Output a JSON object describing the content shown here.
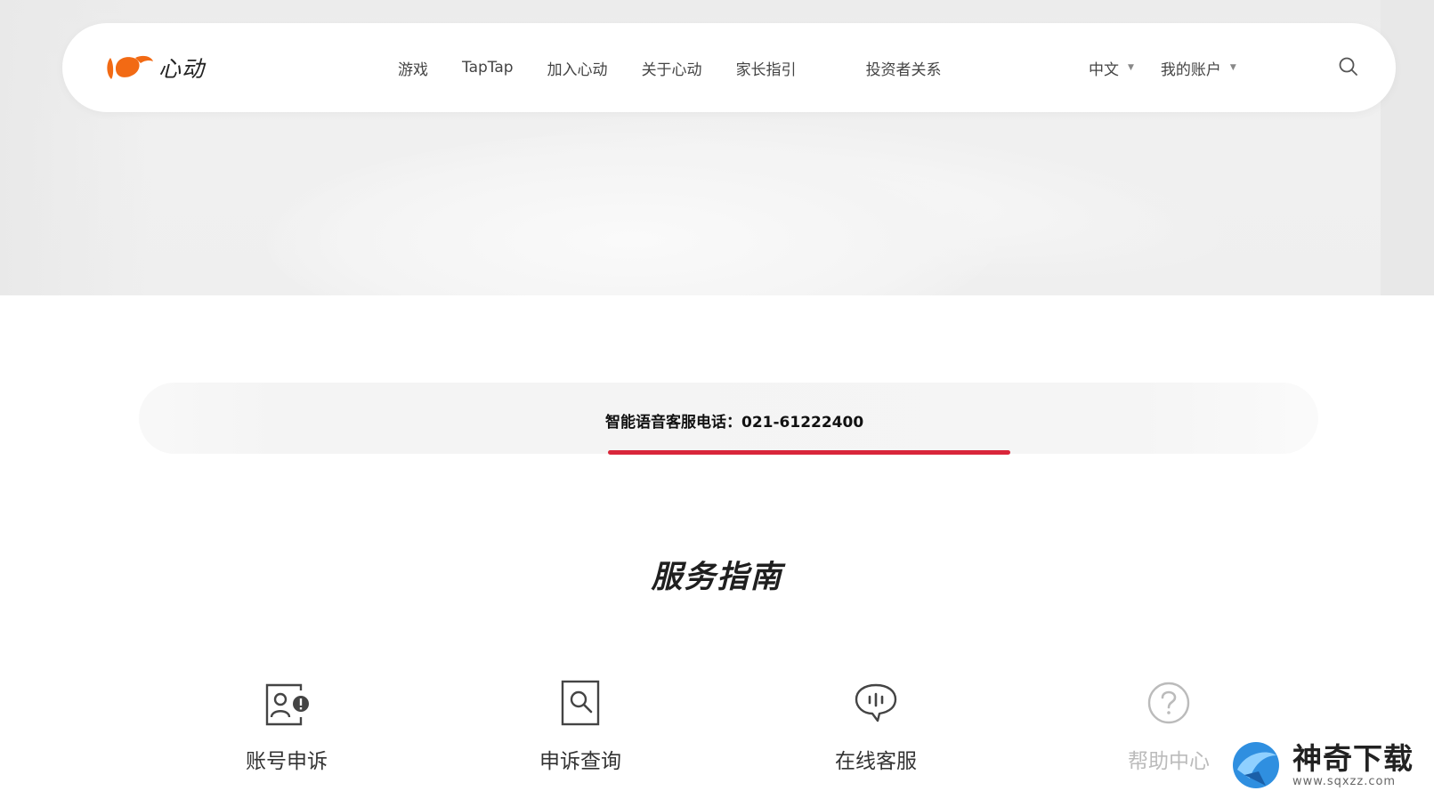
{
  "brand": {
    "name": "心动",
    "logo_color": "#f26a14"
  },
  "nav": {
    "items": [
      {
        "label": "游戏"
      },
      {
        "label": "TapTap"
      },
      {
        "label": "加入心动"
      },
      {
        "label": "关于心动"
      },
      {
        "label": "家长指引"
      },
      {
        "label": "投资者关系"
      }
    ],
    "language": {
      "label": "中文"
    },
    "account": {
      "label": "我的账户"
    },
    "search_icon": "search-icon"
  },
  "banner": {
    "phone_label": "智能语音客服电话：021-61222400",
    "accent_color": "#d9263a"
  },
  "services": {
    "title": "服务指南",
    "items": [
      {
        "label": "账号申诉",
        "icon": "account-appeal-icon"
      },
      {
        "label": "申诉查询",
        "icon": "appeal-search-icon"
      },
      {
        "label": "在线客服",
        "icon": "chat-support-icon"
      },
      {
        "label": "帮助中心",
        "icon": "help-question-icon"
      }
    ]
  },
  "watermark": {
    "title": "神奇下载",
    "url": "www.sqxzz.com"
  }
}
